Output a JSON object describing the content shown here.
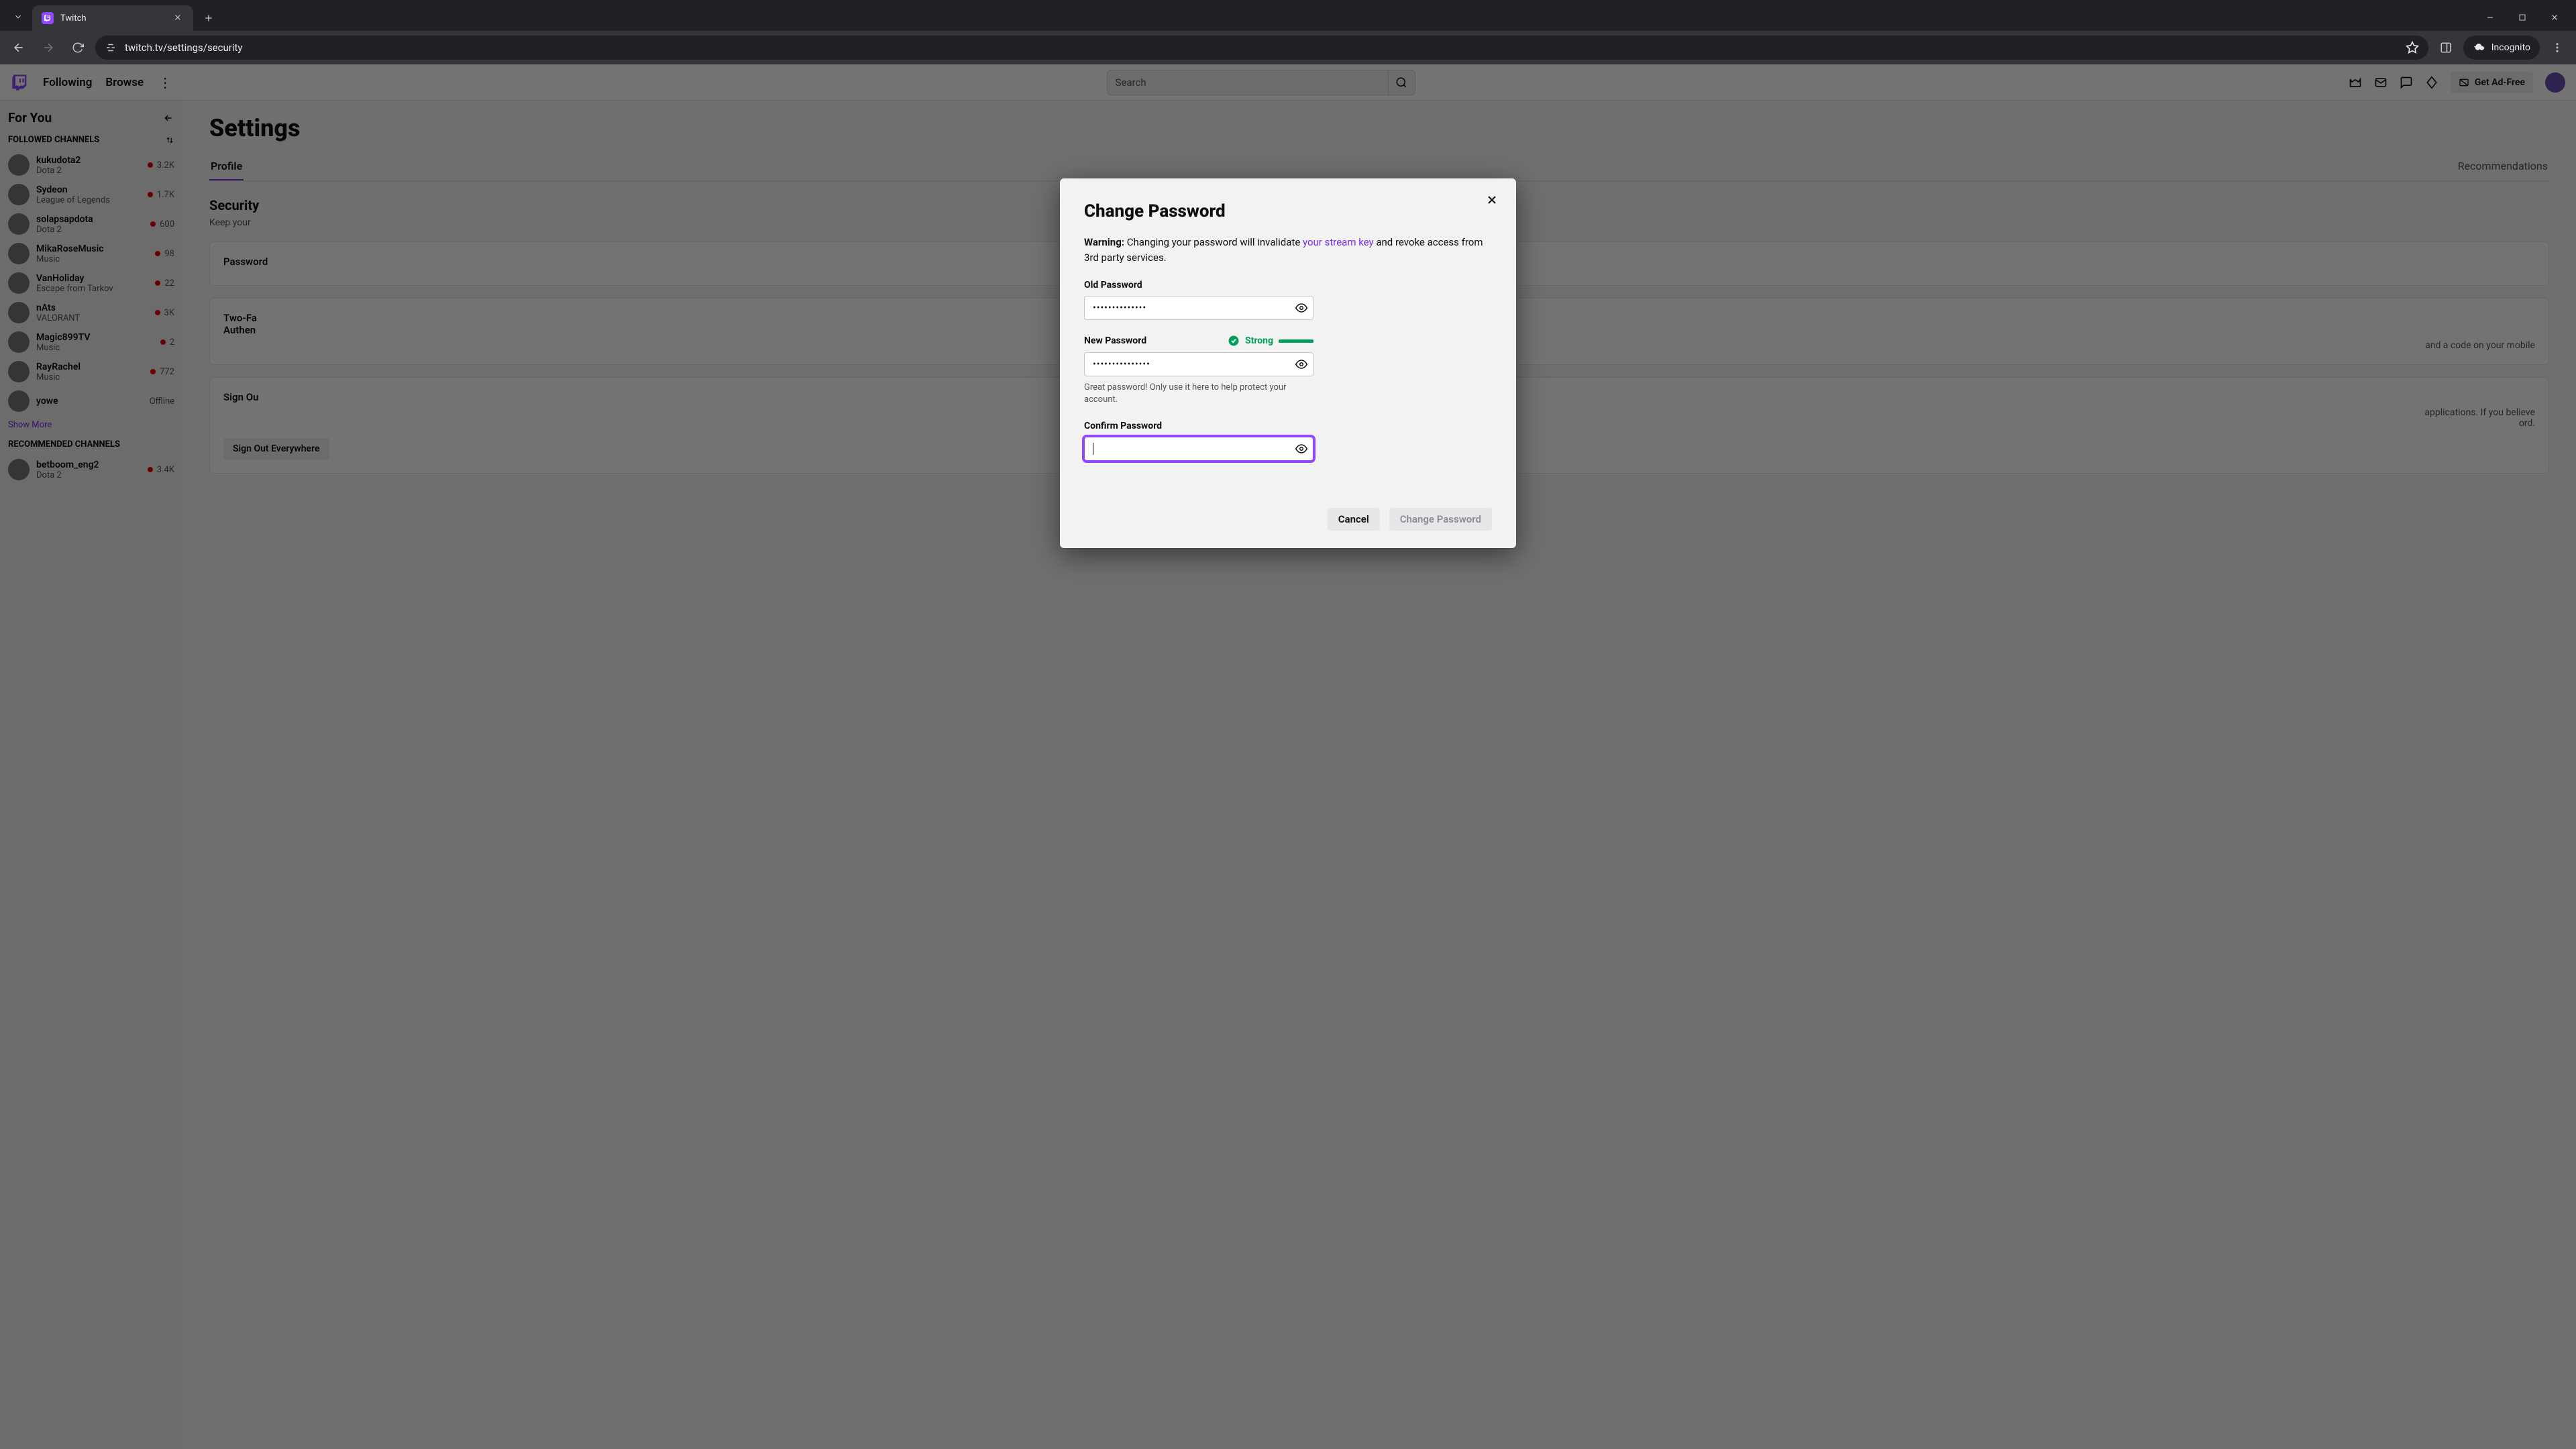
{
  "browser": {
    "tab_title": "Twitch",
    "url": "twitch.tv/settings/security",
    "incognito_label": "Incognito"
  },
  "nav": {
    "following": "Following",
    "browse": "Browse",
    "search_placeholder": "Search",
    "adfree": "Get Ad-Free"
  },
  "sidebar": {
    "for_you": "For You",
    "followed_label": "FOLLOWED CHANNELS",
    "recommended_label": "RECOMMENDED CHANNELS",
    "show_more": "Show More",
    "followed": [
      {
        "name": "kukudota2",
        "game": "Dota 2",
        "viewers": "3.2K",
        "live": true
      },
      {
        "name": "Sydeon",
        "game": "League of Legends",
        "viewers": "1.7K",
        "live": true
      },
      {
        "name": "solapsapdota",
        "game": "Dota 2",
        "viewers": "600",
        "live": true
      },
      {
        "name": "MikaRoseMusic",
        "game": "Music",
        "viewers": "98",
        "live": true
      },
      {
        "name": "VanHoliday",
        "game": "Escape from Tarkov",
        "viewers": "22",
        "live": true
      },
      {
        "name": "nAts",
        "game": "VALORANT",
        "viewers": "3K",
        "live": true
      },
      {
        "name": "Magic899TV",
        "game": "Music",
        "viewers": "2",
        "live": true
      },
      {
        "name": "RayRachel",
        "game": "Music",
        "viewers": "772",
        "live": true
      },
      {
        "name": "yowe",
        "game": "",
        "viewers": "Offline",
        "live": false
      }
    ],
    "recommended": [
      {
        "name": "betboom_eng2",
        "game": "Dota 2",
        "viewers": "3.4K",
        "live": true
      }
    ]
  },
  "settings": {
    "title": "Settings",
    "tabs": {
      "profile": "Profile",
      "recommendations": "Recommendations"
    },
    "security_heading": "Security",
    "security_sub": "Keep your",
    "password_label": "Password",
    "twofa_label_a": "Two-Fa",
    "twofa_label_b": "Authen",
    "twofa_desc": "and a code on your mobile",
    "signout_label": "Sign Ou",
    "signout_desc_a": "applications. If you believe",
    "signout_desc_b": "ord.",
    "signout_button": "Sign Out Everywhere"
  },
  "modal": {
    "title": "Change Password",
    "warning_strong": "Warning:",
    "warning_a": " Changing your password will invalidate ",
    "warning_link": "your stream key",
    "warning_b": " and revoke access from 3rd party services.",
    "old_label": "Old Password",
    "old_value": "••••••••••••••",
    "new_label": "New Password",
    "new_value": "•••••••••••••••",
    "strength_label": "Strong",
    "hint": "Great password! Only use it here to help protect your account.",
    "confirm_label": "Confirm Password",
    "confirm_value": "",
    "cancel": "Cancel",
    "submit": "Change Password"
  }
}
